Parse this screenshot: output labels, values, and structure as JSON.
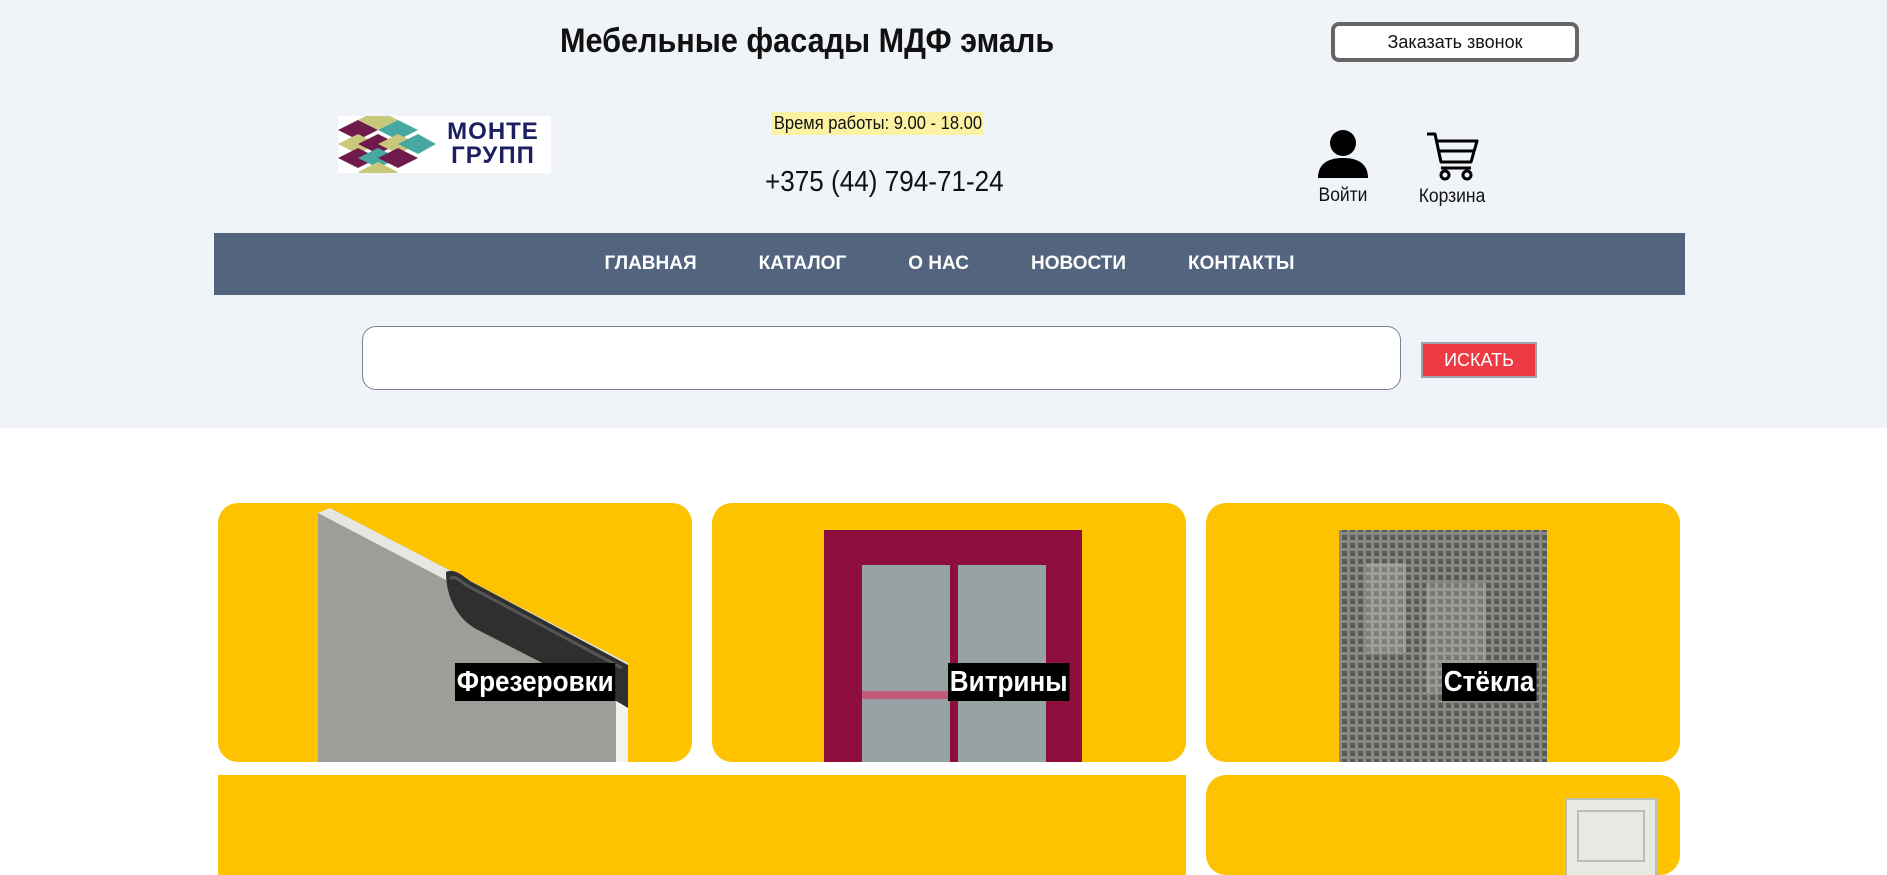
{
  "header": {
    "title": "Мебельные фасады МДФ эмаль",
    "callback_button": "Заказать звонок",
    "logo_text_line1": "МОНТЕ",
    "logo_text_line2": "ГРУПП",
    "hours": "Время работы: 9.00 - 18.00",
    "phone": "+375 (44) 794-71-24",
    "login_label": "Войти",
    "cart_label": "Корзина"
  },
  "nav": {
    "items": [
      {
        "label": "ГЛАВНАЯ"
      },
      {
        "label": "КАТАЛОГ"
      },
      {
        "label": "О НАС"
      },
      {
        "label": "НОВОСТИ"
      },
      {
        "label": "КОНТАКТЫ"
      }
    ]
  },
  "search": {
    "value": "",
    "placeholder": "",
    "button_label": "ИСКАТЬ"
  },
  "categories": [
    {
      "label": "Фрезеровки",
      "icon": "milling-profile-image"
    },
    {
      "label": "Витрины",
      "icon": "glass-cabinet-door-image"
    },
    {
      "label": "Стёкла",
      "icon": "textured-glass-image"
    },
    {
      "label": "",
      "icon": ""
    },
    {
      "label": "",
      "icon": "panel-door-image"
    }
  ],
  "colors": {
    "header_bg": "#f0f4f8",
    "nav_bg": "#53647f",
    "card_bg": "#fdc300",
    "search_button": "#ee3a44",
    "hours_highlight": "#fbf3a3"
  }
}
